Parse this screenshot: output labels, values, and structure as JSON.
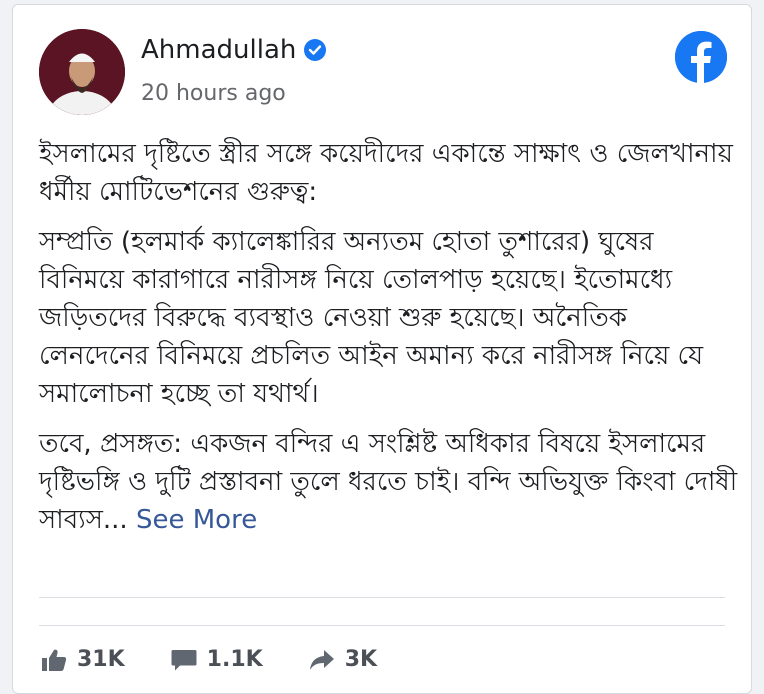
{
  "post": {
    "author": "Ahmadullah",
    "time": "20 hours ago",
    "title": "ইসলামের দৃষ্টিতে স্ত্রীর সঙ্গে কয়েদীদের একান্তে সাক্ষাৎ ও জেলখানায় ধর্মীয় মোটিভেশনের গুরুত্ব:",
    "para1": "সম্প্রতি (হলমার্ক ক্যালেঙ্কারির অন্যতম হোতা তুশারের) ঘুষের বিনিময়ে কারাগারে নারীসঙ্গ নিয়ে তোলপাড় হয়েছে। ইতোমধ্যে জড়িতদের বিরুদ্ধে ব্যবস্থাও নেওয়া শুরু হয়েছে। অনৈতিক লেনদেনের বিনিময়ে প্রচলিত আইন অমান্য করে নারীসঙ্গ নিয়ে যে সমালোচনা হচ্ছে তা যথার্থ।",
    "para2": "তবে, প্রসঙ্গত: একজন বন্দির এ সংশ্লিষ্ট অধিকার বিষয়ে ইসলামের দৃষ্টিভঙ্গি ও দুটি প্রস্তাবনা তুলে ধরতে চাই। বন্দি অভিযুক্ত কিংবা দোষী সাব্যস...",
    "see_more": "See More"
  },
  "stats": {
    "likes": "31K",
    "comments": "1.1K",
    "shares": "3K"
  },
  "colors": {
    "facebook_blue": "#1877f2",
    "link": "#365899"
  },
  "icons": [
    "verified-badge-icon",
    "facebook-logo-icon",
    "like-icon",
    "comment-icon",
    "share-icon"
  ]
}
